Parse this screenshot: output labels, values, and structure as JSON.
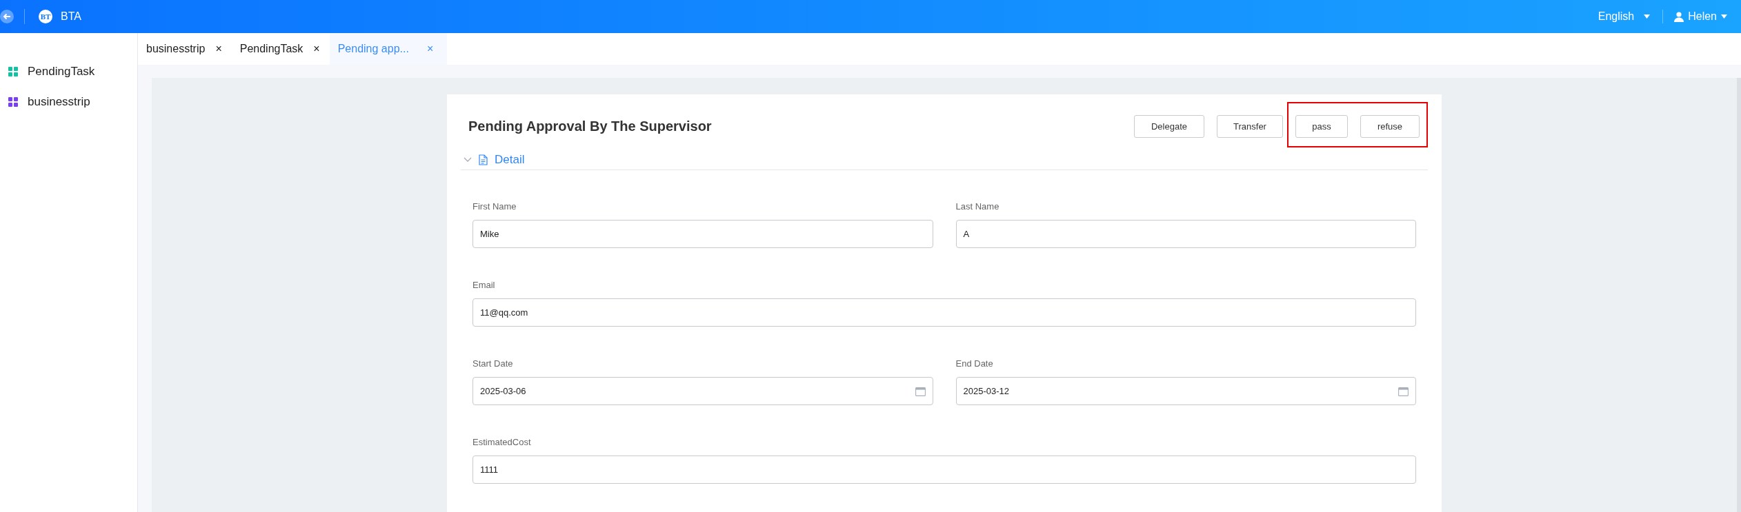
{
  "header": {
    "logo_text": "BT",
    "app_name": "BTA",
    "language": "English",
    "user": "Helen"
  },
  "sidebar": {
    "items": [
      {
        "label": "PendingTask",
        "color": "#13c2a3"
      },
      {
        "label": "businesstrip",
        "color": "#7b3ff2"
      }
    ]
  },
  "tabs": [
    {
      "label": "businesstrip",
      "selected": false,
      "close": "×"
    },
    {
      "label": "PendingTask",
      "selected": false,
      "close": "×"
    },
    {
      "label": "Pending app...",
      "selected": true,
      "close": "×"
    }
  ],
  "form": {
    "title": "Pending Approval By The Supervisor",
    "buttons": [
      {
        "label": "Delegate",
        "highlighted": false
      },
      {
        "label": "Transfer",
        "highlighted": false
      },
      {
        "label": "pass",
        "highlighted": true
      },
      {
        "label": "refuse",
        "highlighted": true
      }
    ],
    "section": {
      "title": "Detail",
      "expanded": true
    },
    "rows": [
      [
        {
          "label": "First Name",
          "value": "Mike",
          "kind": "text"
        },
        {
          "label": "Last Name",
          "value": "A",
          "kind": "text"
        }
      ],
      [
        {
          "label": "Email",
          "value": "11@qq.com",
          "kind": "text"
        }
      ],
      [
        {
          "label": "Start Date",
          "value": "2025-03-06",
          "kind": "date"
        },
        {
          "label": "End Date",
          "value": "2025-03-12",
          "kind": "date"
        }
      ],
      [
        {
          "label": "EstimatedCost",
          "value": "1111",
          "kind": "text"
        }
      ]
    ]
  }
}
